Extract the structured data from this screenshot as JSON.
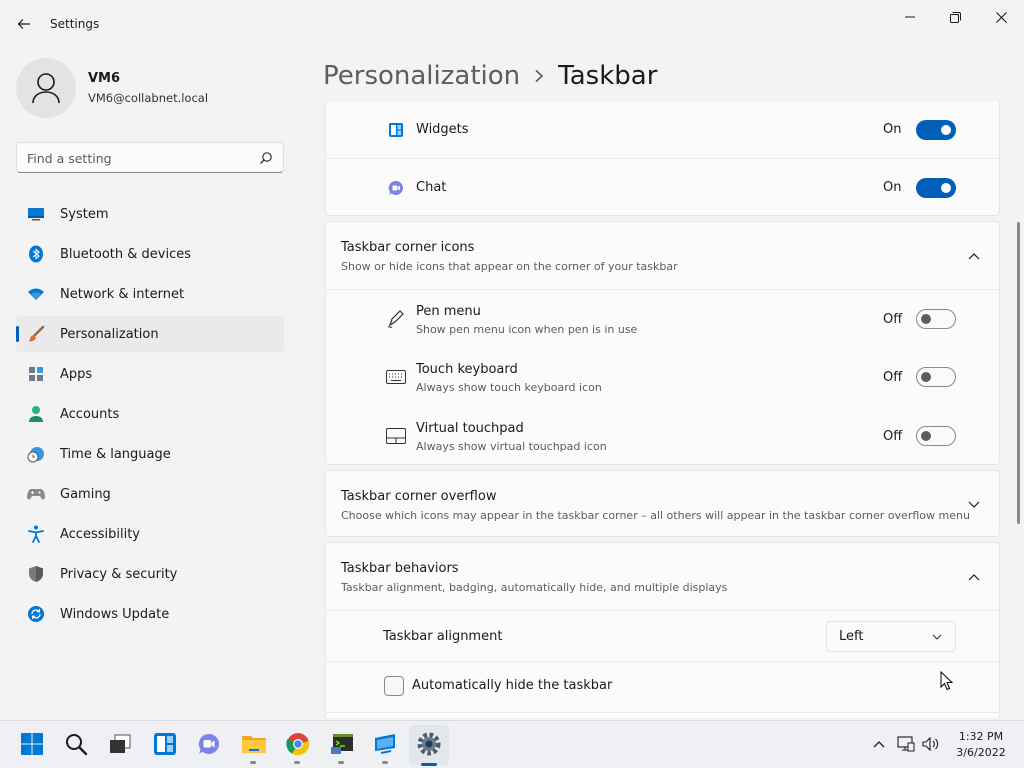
{
  "window": {
    "title": "Settings"
  },
  "profile": {
    "name": "VM6",
    "email": "VM6@collabnet.local"
  },
  "search": {
    "placeholder": "Find a setting"
  },
  "sidebar": {
    "items": [
      {
        "label": "System",
        "icon": "system-icon"
      },
      {
        "label": "Bluetooth & devices",
        "icon": "bluetooth-icon"
      },
      {
        "label": "Network & internet",
        "icon": "wifi-icon"
      },
      {
        "label": "Personalization",
        "icon": "brush-icon",
        "selected": true
      },
      {
        "label": "Apps",
        "icon": "apps-icon"
      },
      {
        "label": "Accounts",
        "icon": "person-icon"
      },
      {
        "label": "Time & language",
        "icon": "clock-globe-icon"
      },
      {
        "label": "Gaming",
        "icon": "gamepad-icon"
      },
      {
        "label": "Accessibility",
        "icon": "accessibility-icon"
      },
      {
        "label": "Privacy & security",
        "icon": "shield-icon"
      },
      {
        "label": "Windows Update",
        "icon": "update-icon"
      }
    ]
  },
  "breadcrumb": {
    "parent": "Personalization",
    "current": "Taskbar"
  },
  "taskbar_items": {
    "widgets": {
      "label": "Widgets",
      "state": "On"
    },
    "chat": {
      "label": "Chat",
      "state": "On"
    }
  },
  "corner_icons": {
    "title": "Taskbar corner icons",
    "subtitle": "Show or hide icons that appear on the corner of your taskbar",
    "items": [
      {
        "label": "Pen menu",
        "sub": "Show pen menu icon when pen is in use",
        "state": "Off"
      },
      {
        "label": "Touch keyboard",
        "sub": "Always show touch keyboard icon",
        "state": "Off"
      },
      {
        "label": "Virtual touchpad",
        "sub": "Always show virtual touchpad icon",
        "state": "Off"
      }
    ]
  },
  "corner_overflow": {
    "title": "Taskbar corner overflow",
    "subtitle": "Choose which icons may appear in the taskbar corner – all others will appear in the taskbar corner overflow menu"
  },
  "behaviors": {
    "title": "Taskbar behaviors",
    "subtitle": "Taskbar alignment, badging, automatically hide, and multiple displays",
    "alignment_label": "Taskbar alignment",
    "alignment_value": "Left",
    "autohide_label": "Automatically hide the taskbar"
  },
  "clock": {
    "time": "1:32 PM",
    "date": "3/6/2022"
  },
  "colors": {
    "accent": "#005fb8",
    "background": "#f3f3f3",
    "card": "#fbfbfb"
  }
}
